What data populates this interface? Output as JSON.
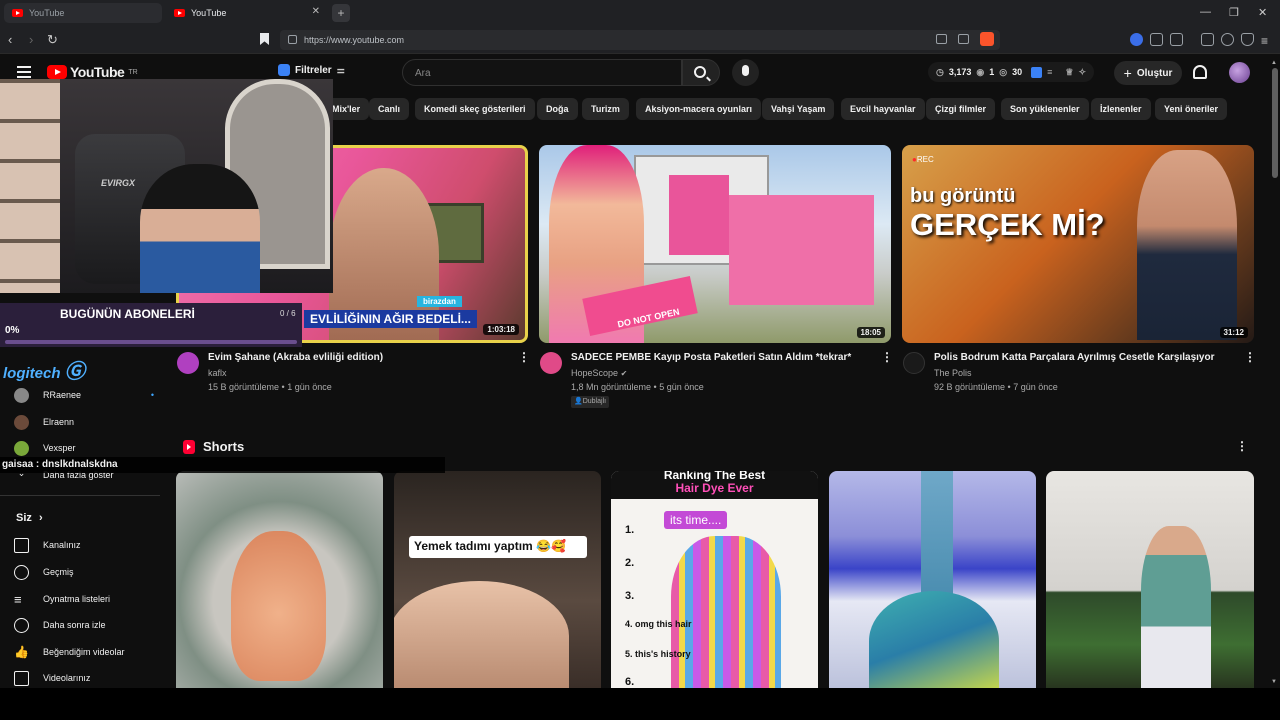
{
  "browser": {
    "tabs": [
      {
        "label": "YouTube",
        "active": false
      },
      {
        "label": "YouTube",
        "active": true
      }
    ],
    "url": "https://www.youtube.com",
    "new_tab_icon": "+"
  },
  "header": {
    "logo_text": "YouTube",
    "region": "TR",
    "filters_label": "Filtreler",
    "search_placeholder": "Ara",
    "stats": {
      "views": "3,173",
      "eye": "1",
      "comments": "30"
    },
    "create_label": "Oluştur",
    "create_icon": "+"
  },
  "chips": [
    "Mix'ler",
    "Canlı",
    "Komedi skeç gösterileri",
    "Doğa",
    "Turizm",
    "Aksiyon-macera oyunları",
    "Vahşi Yaşam",
    "Evcil hayvanlar",
    "Çizgi filmler",
    "Son yüklenenler",
    "İzlenenler",
    "Yeni öneriler"
  ],
  "videos": [
    {
      "title": "Evim Şahane (Akraba evliliği edition)",
      "channel": "kaflx",
      "meta": "15 B görüntüleme • 1 gün önce",
      "duration": "1:03:18",
      "overlay_top": "birazdan",
      "overlay_text": "EVLİLİĞİNIN AĞIR BEDELİ...",
      "avatar_color": "#b040c0"
    },
    {
      "title": "SADECE PEMBE Kayıp Posta Paketleri Satın Aldım *tekrar*",
      "channel": "HopeScope",
      "verified": "✔",
      "meta": "1,8 Mn görüntüleme • 5 gün önce",
      "badge": "Dublajlı",
      "duration": "18:05",
      "overlay_text": "DO NOT OPEN",
      "avatar_color": "#e04a88"
    },
    {
      "title": "Polis Bodrum Katta Parçalara Ayrılmış Cesetle Karşılaşıyor",
      "channel": "The Polis",
      "meta": "92 B görüntüleme • 7 gün önce",
      "duration": "31:12",
      "overlay_small": "bu görüntü",
      "overlay_big": "GERÇEK Mİ?",
      "rec": "REC",
      "avatar_color": "#1a1a1a"
    }
  ],
  "sidebar": {
    "subs": [
      {
        "label": "RRaenee",
        "dot": "•"
      },
      {
        "label": "Elraenn",
        "dot": ""
      },
      {
        "label": "Vexsper",
        "dot": ""
      }
    ],
    "show_more": "Daha fazla göster",
    "you_label": "Siz",
    "you_chevron": "›",
    "you_items": [
      "Kanalınız",
      "Geçmiş",
      "Oynatma listeleri",
      "Daha sonra izle",
      "Beğendiğim videolar",
      "Videolarınız"
    ]
  },
  "overlays": {
    "subs_title": "BUGÜNÜN ABONELERİ",
    "subs_count": "0 / 6",
    "subs_percent": "0%",
    "subs_progress": 0,
    "logitech": "logitech",
    "chat_user": "gaisaa",
    "chat_sep": ":",
    "chat_msg": "dnslkdnalskdna",
    "chair_brand": "EVIRGX"
  },
  "shorts": {
    "title": "Shorts",
    "items": [
      {
        "caption": ""
      },
      {
        "caption": "Yemek tadımı yaptım 😂🥰"
      },
      {
        "caption": "Ranking The Best",
        "caption2": "Hair Dye Ever",
        "caption3": "its time....",
        "list": [
          "1.",
          "2.",
          "3.",
          "4. omg this hair",
          "5. this's history",
          "6."
        ]
      },
      {
        "caption": ""
      },
      {
        "caption": ""
      }
    ]
  }
}
